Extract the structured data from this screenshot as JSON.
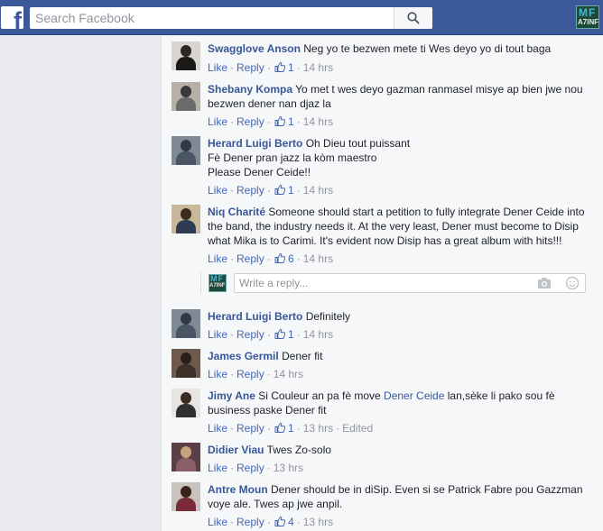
{
  "header": {
    "logo_letter": "f",
    "search_placeholder": "Search Facebook",
    "brand_top": "MF",
    "brand_bottom": "A7INF"
  },
  "labels": {
    "like": "Like",
    "reply": "Reply",
    "sep": "·"
  },
  "composer": {
    "placeholder": "Write a reply...",
    "brand_top": "MF",
    "brand_bottom": "A7INF"
  },
  "comments": [
    {
      "author": "Swagglove Anson",
      "text": "Neg yo te bezwen mete ti Wes deyo yo di tout baga",
      "likes": "1",
      "time": "14 hrs"
    },
    {
      "author": "Shebany Kompa",
      "text": "Yo met t wes deyo gazman ranmasel misye ap bien jwe nou bezwen dener nan djaz la",
      "likes": "1",
      "time": "14 hrs"
    },
    {
      "author": "Herard Luigi Berto",
      "text_lines": [
        "Oh Dieu tout puissant",
        "Fè Dener pran jazz la kòm maestro",
        "Please Dener Ceide!!"
      ],
      "likes": "1",
      "time": "14 hrs"
    },
    {
      "author": "Niq Charité",
      "text": "Someone should start a petition to fully integrate Dener Ceide into the band, the industry needs it. At the very least, Dener must become to Disip what Mika is to Carimi. It's evident now Disip has a great album with hits!!!",
      "likes": "6",
      "time": "14 hrs"
    },
    {
      "author": "Herard Luigi Berto",
      "text": "Definitely",
      "likes": "1",
      "time": "14 hrs"
    },
    {
      "author": "James Germil",
      "text": "Dener fit",
      "likes": "",
      "time": "14 hrs"
    },
    {
      "author": "Jimy Ane",
      "text_before": "Si Couleur an pa fè move",
      "mention": "Dener Ceide",
      "text_after": "lan,sèke li pako sou fè business paske Dener fit",
      "likes": "1",
      "time": "13 hrs",
      "edited": "Edited"
    },
    {
      "author": "Didier Viau",
      "text": "Twes Zo-solo",
      "likes": "",
      "time": "13 hrs"
    },
    {
      "author": "Antre Moun",
      "text": "Dener should be in diSip. Even si se Patrick Fabre pou Gazzman voye ale. Twes ap jwe anpil.",
      "likes": "4",
      "time": "13 hrs"
    }
  ],
  "colors": {
    "topbar": "#3b5998",
    "link": "#365899",
    "action_link": "#4267b2",
    "meta": "#90949c"
  }
}
